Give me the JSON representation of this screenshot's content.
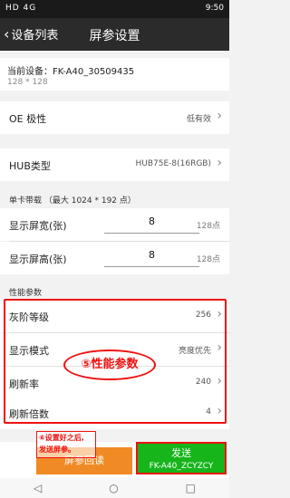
{
  "status": {
    "left": "HD 4G",
    "right": "9:50"
  },
  "header": {
    "back_label": "设备列表",
    "title": "屏参设置"
  },
  "device": {
    "label": "当前设备：FK-A40_30509435",
    "resolution": "128 * 128"
  },
  "oe": {
    "label": "OE 极性",
    "value": "低有效"
  },
  "hub": {
    "label": "HUB类型",
    "value": "HUB75E-8(16RGB)"
  },
  "card": {
    "section": "单卡带载   （最大    1024 * 192    点）",
    "width_label": "显示屏宽(张)",
    "width_value": "8",
    "width_unit": "128点",
    "height_label": "显示屏高(张)",
    "height_value": "8",
    "height_unit": "128点"
  },
  "perf": {
    "section": "性能参数",
    "gray_label": "灰阶等级",
    "gray_value": "256",
    "mode_label": "显示模式",
    "mode_value": "亮度优先",
    "refresh_label": "刷新率",
    "refresh_value": "240",
    "mult_label": "刷新倍数",
    "mult_value": "4"
  },
  "annotations": {
    "perf_tag": "⑤性能参数",
    "note_line1": "⑥设置好之后,",
    "note_line2": "发送屏参。"
  },
  "buttons": {
    "read": "屏参回读",
    "send": "发送",
    "send_target": "FK-A40_ZCYZCY"
  },
  "nav": {
    "back": "◁",
    "home": "○",
    "recent": "□"
  },
  "colors": {
    "accent_orange": "#f08a24",
    "send_green": "#16b51a",
    "annotation_red": "#e11111"
  }
}
